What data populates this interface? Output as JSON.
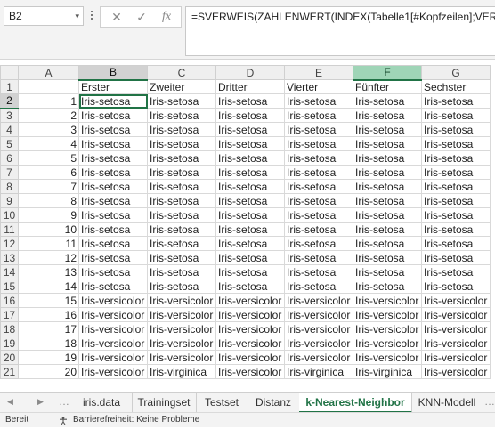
{
  "name_box": "B2",
  "formula_buttons": {
    "cancel": "✕",
    "enter": "✓",
    "fx": "fx"
  },
  "formula": "=SVERWEIS(ZAHLENWERT(INDEX(Tabelle1[#Kopfzeilen];VERGLEICH",
  "columns": [
    "A",
    "B",
    "C",
    "D",
    "E",
    "F",
    "G"
  ],
  "headers": [
    "",
    "Erster",
    "Zweiter",
    "Dritter",
    "Vierter",
    "Fünfter",
    "Sechster"
  ],
  "rows": [
    {
      "n": "2",
      "idx": "1",
      "vals": [
        "Iris-setosa",
        "Iris-setosa",
        "Iris-setosa",
        "Iris-setosa",
        "Iris-setosa",
        "Iris-setosa"
      ]
    },
    {
      "n": "3",
      "idx": "2",
      "vals": [
        "Iris-setosa",
        "Iris-setosa",
        "Iris-setosa",
        "Iris-setosa",
        "Iris-setosa",
        "Iris-setosa"
      ]
    },
    {
      "n": "4",
      "idx": "3",
      "vals": [
        "Iris-setosa",
        "Iris-setosa",
        "Iris-setosa",
        "Iris-setosa",
        "Iris-setosa",
        "Iris-setosa"
      ]
    },
    {
      "n": "5",
      "idx": "4",
      "vals": [
        "Iris-setosa",
        "Iris-setosa",
        "Iris-setosa",
        "Iris-setosa",
        "Iris-setosa",
        "Iris-setosa"
      ]
    },
    {
      "n": "6",
      "idx": "5",
      "vals": [
        "Iris-setosa",
        "Iris-setosa",
        "Iris-setosa",
        "Iris-setosa",
        "Iris-setosa",
        "Iris-setosa"
      ]
    },
    {
      "n": "7",
      "idx": "6",
      "vals": [
        "Iris-setosa",
        "Iris-setosa",
        "Iris-setosa",
        "Iris-setosa",
        "Iris-setosa",
        "Iris-setosa"
      ]
    },
    {
      "n": "8",
      "idx": "7",
      "vals": [
        "Iris-setosa",
        "Iris-setosa",
        "Iris-setosa",
        "Iris-setosa",
        "Iris-setosa",
        "Iris-setosa"
      ]
    },
    {
      "n": "9",
      "idx": "8",
      "vals": [
        "Iris-setosa",
        "Iris-setosa",
        "Iris-setosa",
        "Iris-setosa",
        "Iris-setosa",
        "Iris-setosa"
      ]
    },
    {
      "n": "10",
      "idx": "9",
      "vals": [
        "Iris-setosa",
        "Iris-setosa",
        "Iris-setosa",
        "Iris-setosa",
        "Iris-setosa",
        "Iris-setosa"
      ]
    },
    {
      "n": "11",
      "idx": "10",
      "vals": [
        "Iris-setosa",
        "Iris-setosa",
        "Iris-setosa",
        "Iris-setosa",
        "Iris-setosa",
        "Iris-setosa"
      ]
    },
    {
      "n": "12",
      "idx": "11",
      "vals": [
        "Iris-setosa",
        "Iris-setosa",
        "Iris-setosa",
        "Iris-setosa",
        "Iris-setosa",
        "Iris-setosa"
      ]
    },
    {
      "n": "13",
      "idx": "12",
      "vals": [
        "Iris-setosa",
        "Iris-setosa",
        "Iris-setosa",
        "Iris-setosa",
        "Iris-setosa",
        "Iris-setosa"
      ]
    },
    {
      "n": "14",
      "idx": "13",
      "vals": [
        "Iris-setosa",
        "Iris-setosa",
        "Iris-setosa",
        "Iris-setosa",
        "Iris-setosa",
        "Iris-setosa"
      ]
    },
    {
      "n": "15",
      "idx": "14",
      "vals": [
        "Iris-setosa",
        "Iris-setosa",
        "Iris-setosa",
        "Iris-setosa",
        "Iris-setosa",
        "Iris-setosa"
      ]
    },
    {
      "n": "16",
      "idx": "15",
      "vals": [
        "Iris-versicolor",
        "Iris-versicolor",
        "Iris-versicolor",
        "Iris-versicolor",
        "Iris-versicolor",
        "Iris-versicolor"
      ]
    },
    {
      "n": "17",
      "idx": "16",
      "vals": [
        "Iris-versicolor",
        "Iris-versicolor",
        "Iris-versicolor",
        "Iris-versicolor",
        "Iris-versicolor",
        "Iris-versicolor"
      ]
    },
    {
      "n": "18",
      "idx": "17",
      "vals": [
        "Iris-versicolor",
        "Iris-versicolor",
        "Iris-versicolor",
        "Iris-versicolor",
        "Iris-versicolor",
        "Iris-versicolor"
      ]
    },
    {
      "n": "19",
      "idx": "18",
      "vals": [
        "Iris-versicolor",
        "Iris-versicolor",
        "Iris-versicolor",
        "Iris-versicolor",
        "Iris-versicolor",
        "Iris-versicolor"
      ]
    },
    {
      "n": "20",
      "idx": "19",
      "vals": [
        "Iris-versicolor",
        "Iris-versicolor",
        "Iris-versicolor",
        "Iris-versicolor",
        "Iris-versicolor",
        "Iris-versicolor"
      ]
    },
    {
      "n": "21",
      "idx": "20",
      "vals": [
        "Iris-versicolor",
        "Iris-virginica",
        "Iris-versicolor",
        "Iris-virginica",
        "Iris-virginica",
        "Iris-versicolor"
      ]
    }
  ],
  "tabs": [
    "iris.data",
    "Trainingset",
    "Testset",
    "Distanz",
    "k-Nearest-Neighbor",
    "KNN-Modell"
  ],
  "status": {
    "ready": "Bereit",
    "accessibility": "Barrierefreiheit: Keine Probleme"
  },
  "colors": {
    "accent": "#217346",
    "selected_header": "#9fd5b7"
  }
}
